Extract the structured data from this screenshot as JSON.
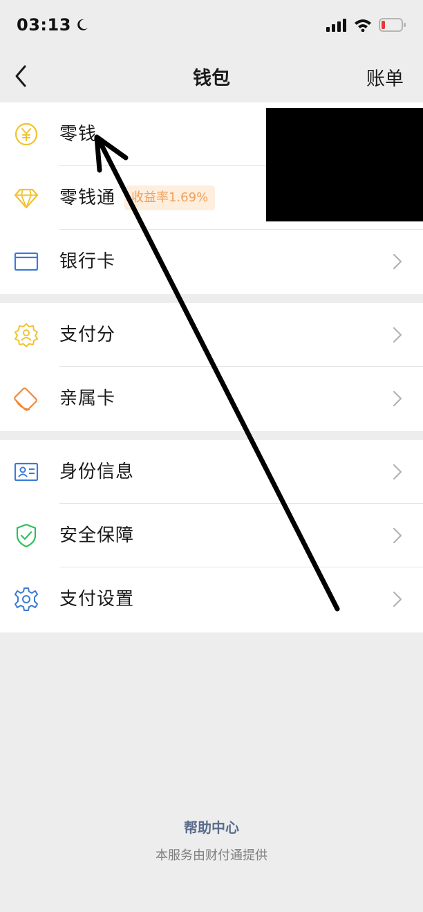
{
  "status_bar": {
    "time": "03:13",
    "icons": [
      "moon-icon",
      "signal-icon",
      "wifi-icon",
      "battery-icon"
    ],
    "battery_color": "#e53935"
  },
  "nav": {
    "back_icon": "chevron-left-icon",
    "title": "钱包",
    "bill_label": "账单"
  },
  "groups": [
    {
      "items": [
        {
          "icon": "yuan-coin-icon",
          "label": "零钱",
          "icon_color": "#f2c230"
        },
        {
          "icon": "diamond-icon",
          "label": "零钱通",
          "badge": "收益率1.69%",
          "icon_color": "#f2c230"
        },
        {
          "icon": "bank-card-icon",
          "label": "银行卡",
          "icon_color": "#3a7bd5"
        }
      ]
    },
    {
      "items": [
        {
          "icon": "pay-score-icon",
          "label": "支付分",
          "icon_color": "#f2c230"
        },
        {
          "icon": "family-card-icon",
          "label": "亲属卡",
          "icon_color": "#f08a3c"
        }
      ]
    },
    {
      "items": [
        {
          "icon": "id-card-icon",
          "label": "身份信息",
          "icon_color": "#3a7bd5"
        },
        {
          "icon": "shield-check-icon",
          "label": "安全保障",
          "icon_color": "#2fbf5a"
        },
        {
          "icon": "gear-icon",
          "label": "支付设置",
          "icon_color": "#3a7bd5"
        }
      ]
    }
  ],
  "footer": {
    "help_center": "帮助中心",
    "provider": "本服务由财付通提供"
  },
  "accent_colors": {
    "link": "#5a6b8c",
    "badge_text": "#f0a05a",
    "badge_bg": "#fdeede"
  }
}
